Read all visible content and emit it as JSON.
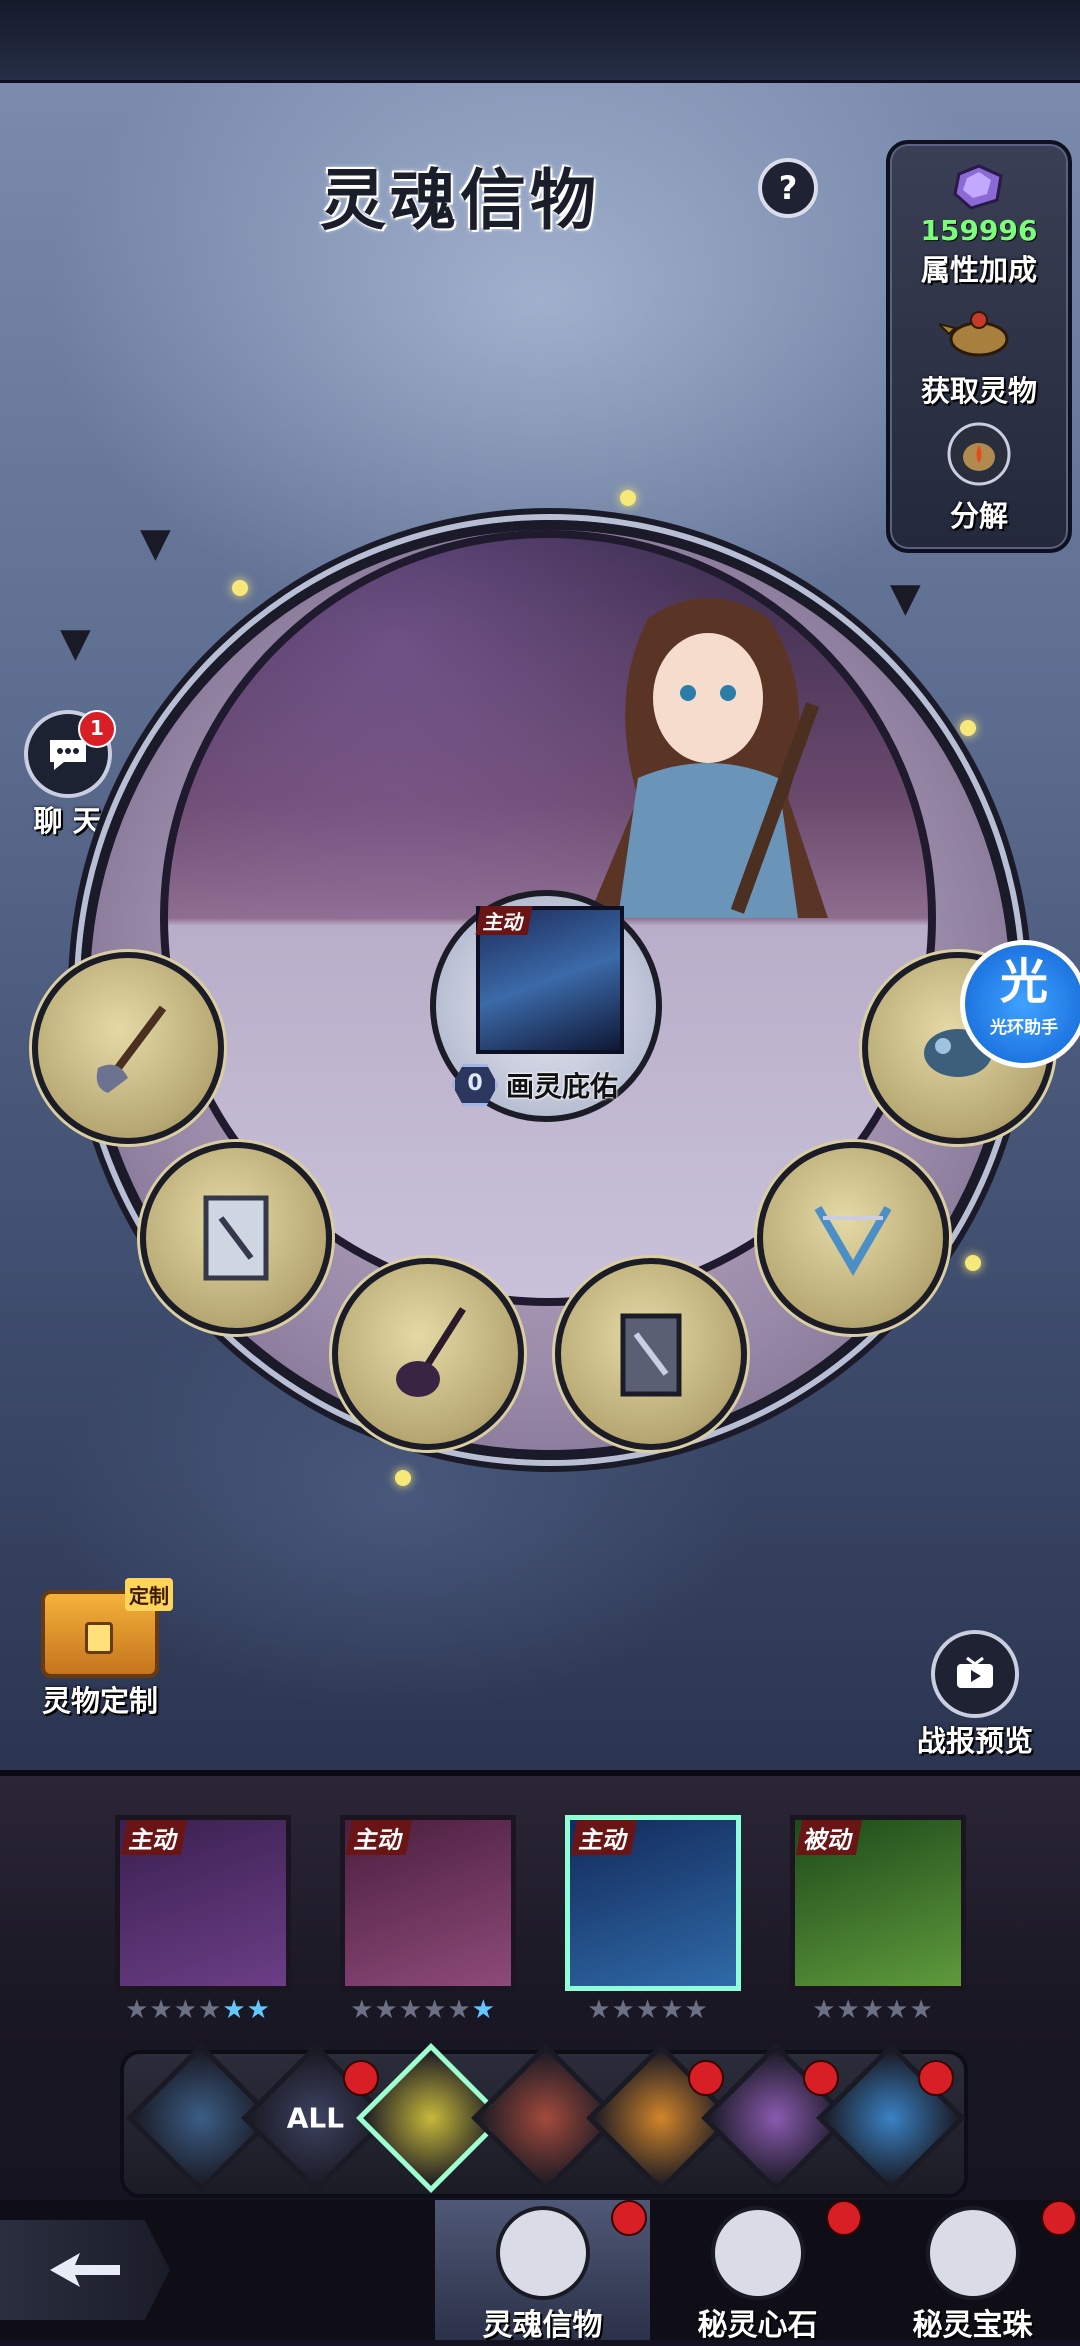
{
  "header": {
    "title": "灵魂信物",
    "help_label": "?"
  },
  "side_panel": {
    "crystal_count": "159996",
    "attribute_bonus": "属性加成",
    "obtain_relic": "获取灵物",
    "decompose": "分解"
  },
  "chat": {
    "label": "聊 天",
    "unread": "1"
  },
  "center": {
    "card_tag": "主动",
    "count": "0",
    "skill_name": "画灵庇佑"
  },
  "assistant": {
    "big": "光",
    "small": "光环助手"
  },
  "custom": {
    "label": "灵物定制",
    "chest_tag": "定制"
  },
  "battle_report": {
    "label": "战报预览"
  },
  "cards": [
    {
      "tag": "主动",
      "colors": [
        "#3a2050",
        "#6b3e86"
      ],
      "stars": "★★★★★★",
      "blue_stars": 2
    },
    {
      "tag": "主动",
      "colors": [
        "#4b1f3f",
        "#8d4a7a"
      ],
      "stars": "★★★★★★",
      "blue_stars": 1
    },
    {
      "tag": "主动",
      "colors": [
        "#132a5a",
        "#2f6aa8"
      ],
      "stars": "★★★★★",
      "blue_stars": 0
    },
    {
      "tag": "被动",
      "colors": [
        "#1e4a1a",
        "#5e9a3c"
      ],
      "stars": "★★★★★",
      "blue_stars": 0
    }
  ],
  "filters": [
    {
      "label": "",
      "color": "#3b5e86"
    },
    {
      "label": "ALL",
      "color": "#3d4260"
    },
    {
      "label": "",
      "color": "#c7b93a"
    },
    {
      "label": "",
      "color": "#a24a3c"
    },
    {
      "label": "",
      "color": "#d1852a"
    },
    {
      "label": "",
      "color": "#8a5ab0"
    },
    {
      "label": "",
      "color": "#3a82c4"
    }
  ],
  "tabs": [
    {
      "label": "灵魂信物",
      "active": true
    },
    {
      "label": "秘灵心石",
      "active": false
    },
    {
      "label": "秘灵宝珠",
      "active": false
    }
  ]
}
